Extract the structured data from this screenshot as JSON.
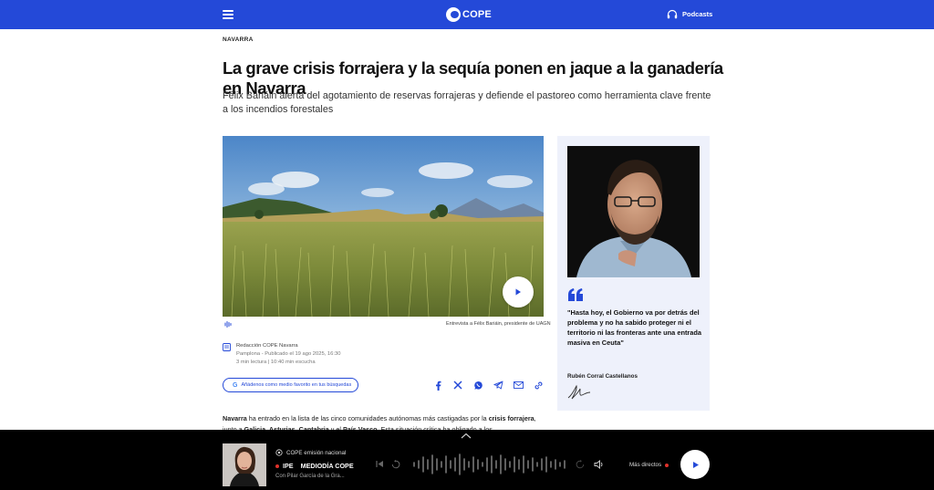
{
  "header": {
    "logo_text": "COPE",
    "podcasts_label": "Podcasts",
    "menu_icon": "hamburger-icon",
    "brand_color": "#2449d8"
  },
  "article": {
    "section": "NAVARRA",
    "headline": "La grave crisis forrajera y la sequía ponen en jaque a la ganadería en Navarra",
    "subtitle": "Félix Bariáin alerta del agotamiento de reservas forrajeras y defiende el pastoreo como herramienta clave frente a los incendios forestales",
    "image_caption": "Entrevista a Félix Bariáin, presidente de UAGN",
    "byline": {
      "author": "Redacción COPE Navarra",
      "published": "Pamplona - Publicado el 19 ago 2025, 16:30",
      "reading": "3 min lectura | 10:40 min escucha"
    },
    "google_button": "Añádenos como medio favorito en tus búsquedas",
    "share_icons": [
      "facebook-icon",
      "x-icon",
      "whatsapp-icon",
      "telegram-icon",
      "mail-icon",
      "link-icon"
    ],
    "body": {
      "lead_bold": "Navarra",
      "lead_text": " ha entrado en la lista de las cinco comunidades autónomas más castigadas por la ",
      "bold2": "crisis forrajera",
      "text2": ", junto a ",
      "bold3": "Galicia, Asturias, Cantabria",
      "text3": " y el ",
      "bold4": "País Vasco",
      "text4": ". Esta situación crítica ha obligado a los"
    }
  },
  "quote_card": {
    "quote": "\"Hasta hoy, el Gobierno va por detrás del problema y no ha sabido proteger ni el territorio ni las fronteras ante una entrada masiva en Ceuta\"",
    "author": "Rubén Corral Castellanos"
  },
  "player": {
    "station": "COPE emisión nacional",
    "tag": "IPE",
    "program": "MEDIODÍA COPE",
    "host": "Con Pilar García de la Gra...",
    "more_live": "Más directos",
    "live_color": "#e0322b"
  }
}
